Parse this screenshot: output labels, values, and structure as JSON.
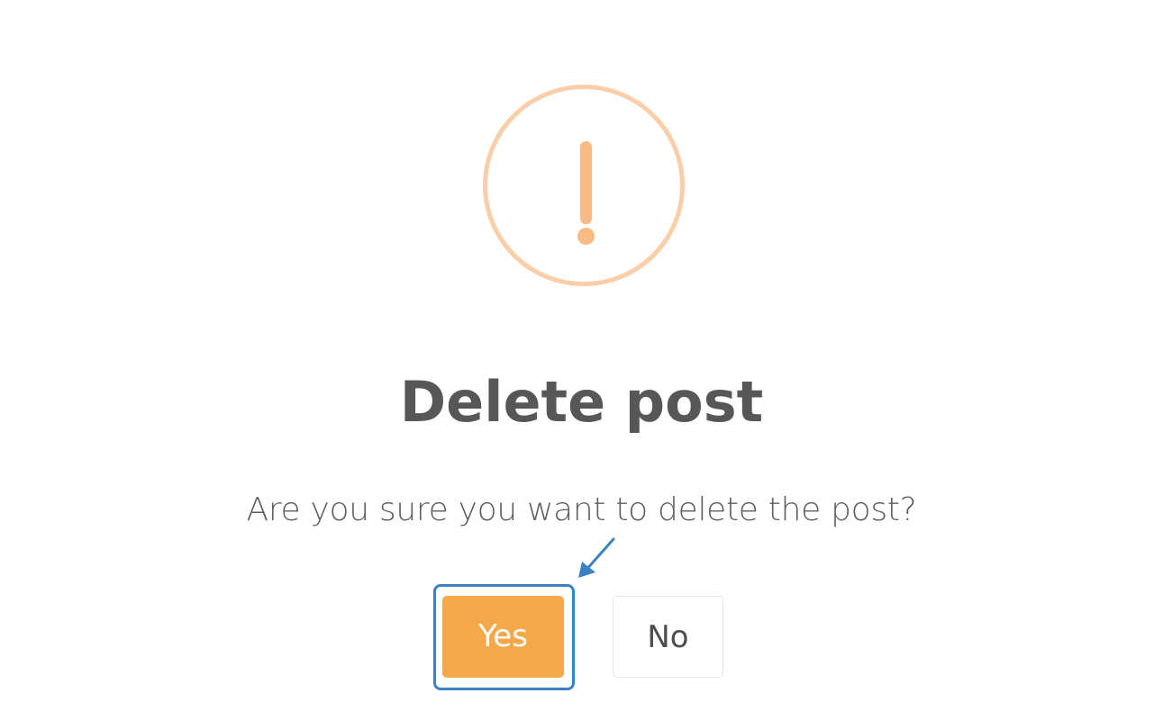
{
  "dialog": {
    "title": "Delete post",
    "message": "Are you sure you want to delete the post?",
    "icon": "warning-exclamation-icon",
    "buttons": {
      "confirm_label": "Yes",
      "cancel_label": "No"
    },
    "highlighted_button": "confirm",
    "pointer_icon": "arrow-pointer-icon"
  },
  "colors": {
    "confirm_button": "#f5a84a",
    "warning_icon": "#f8bb86",
    "warning_ring": "#facea8",
    "highlight": "#3b82c4",
    "title_text": "#575757",
    "message_text": "#5f5f5f"
  }
}
